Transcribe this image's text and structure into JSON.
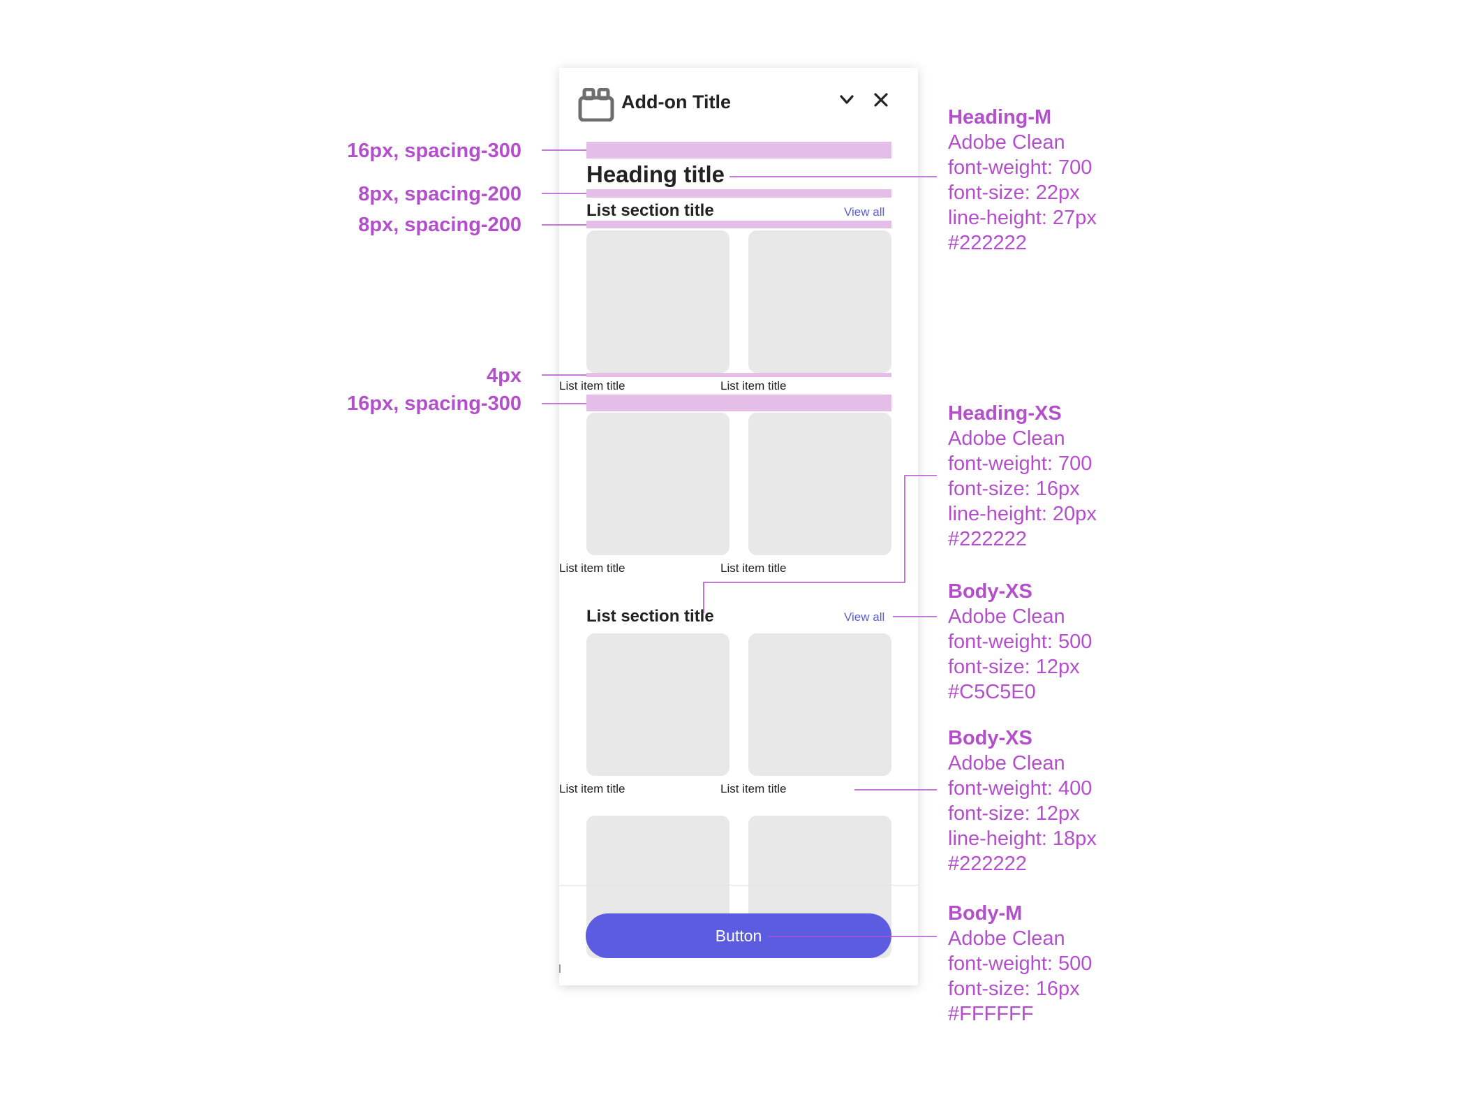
{
  "panel": {
    "title": "Add-on Title",
    "heading": "Heading title",
    "sections": [
      {
        "title": "List section title",
        "link": "View all",
        "items": [
          "List item title",
          "List item title",
          "List item title",
          "List item title"
        ]
      },
      {
        "title": "List section title",
        "link": "View all",
        "items": [
          "List item title",
          "List item title"
        ]
      }
    ],
    "button_label": "Button"
  },
  "spacing_labels": [
    "16px, spacing-300",
    "8px, spacing-200",
    "8px, spacing-200",
    "4px",
    "16px, spacing-300"
  ],
  "specs": [
    {
      "name": "Heading-M",
      "lines": [
        "Adobe Clean",
        "font-weight: 700",
        "font-size: 22px",
        "line-height: 27px",
        "#222222"
      ]
    },
    {
      "name": "Heading-XS",
      "lines": [
        "Adobe Clean",
        "font-weight: 700",
        "font-size: 16px",
        "line-height: 20px",
        "#222222"
      ]
    },
    {
      "name": "Body-XS",
      "lines": [
        "Adobe Clean",
        "font-weight: 500",
        "font-size: 12px",
        "#C5C5E0"
      ]
    },
    {
      "name": "Body-XS",
      "lines": [
        "Adobe Clean",
        "font-weight: 400",
        "font-size: 12px",
        "line-height: 18px",
        "#222222"
      ]
    },
    {
      "name": "Body-M",
      "lines": [
        "Adobe Clean",
        "font-weight: 500",
        "font-size: 16px",
        "#FFFFFF"
      ]
    }
  ],
  "colors": {
    "annotation": "#b44fcc",
    "highlight": "#e4bde9",
    "accent": "#5c5ce0",
    "text": "#222222",
    "tile": "#e8e8e8"
  }
}
